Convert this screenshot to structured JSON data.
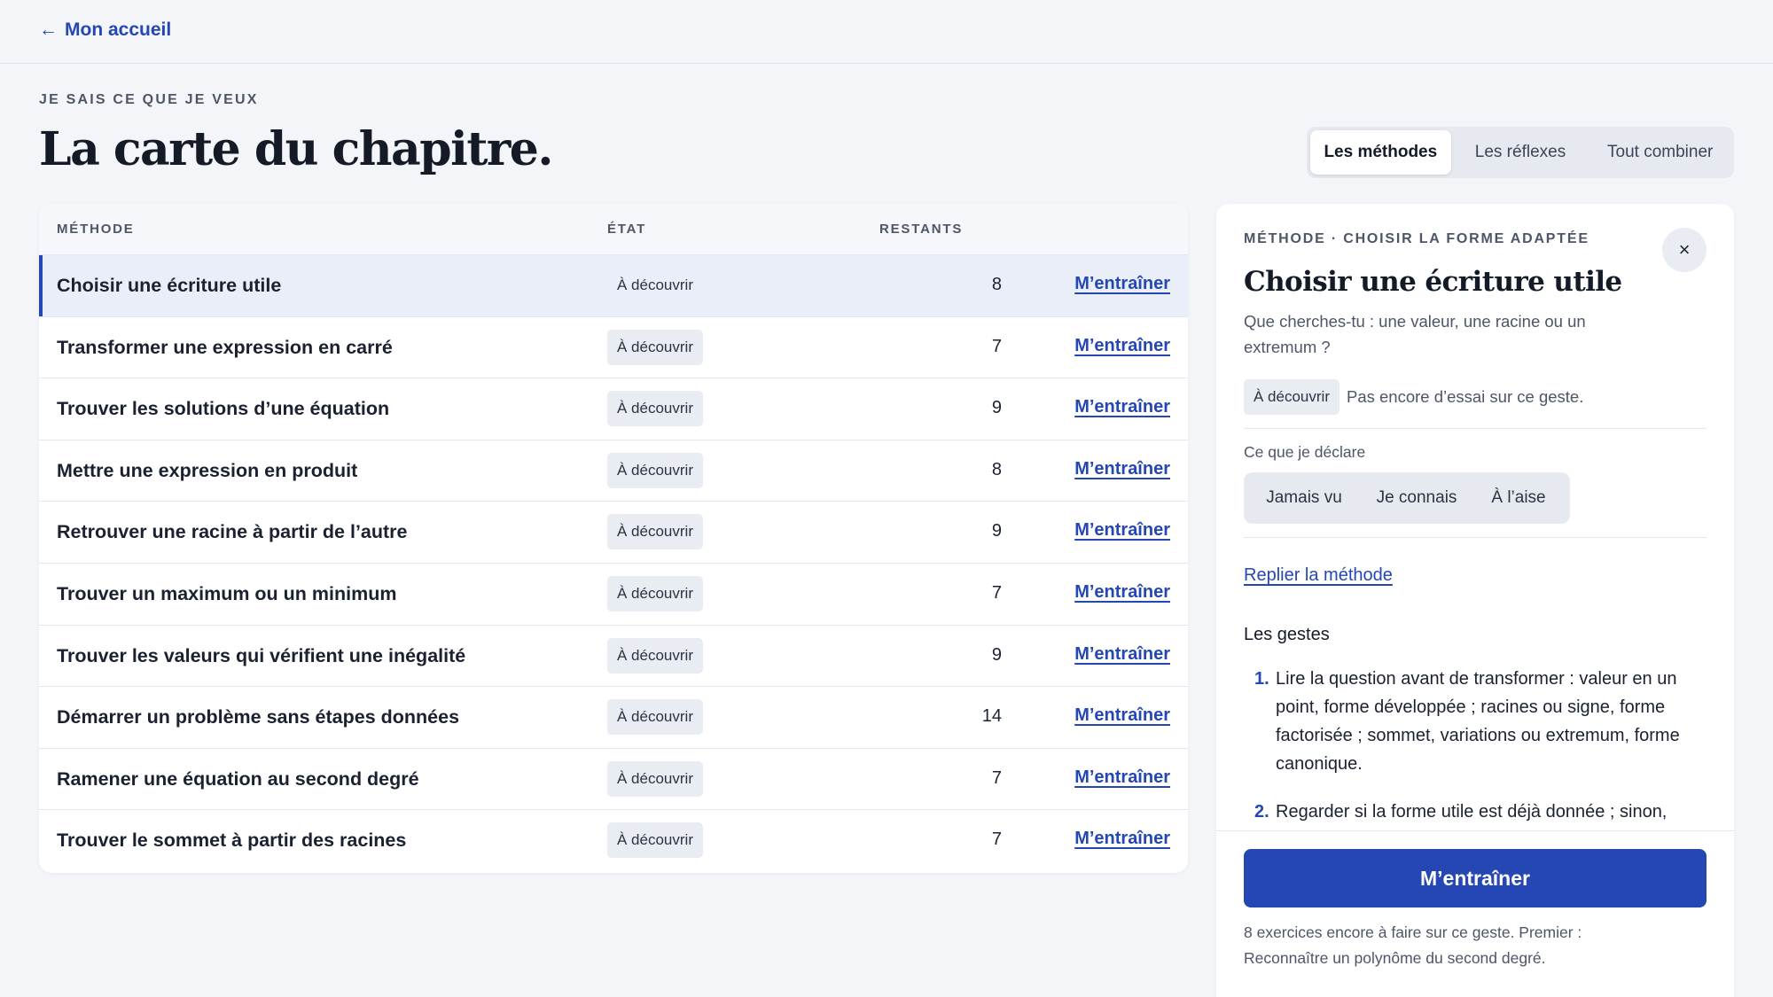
{
  "nav": {
    "back_arrow": "←",
    "back_label": "Mon accueil"
  },
  "header": {
    "eyebrow": "JE SAIS CE QUE JE VEUX",
    "title": "La carte du chapitre."
  },
  "tabs": [
    {
      "label": "Les méthodes",
      "active": true
    },
    {
      "label": "Les réflexes",
      "active": false
    },
    {
      "label": "Tout combiner",
      "active": false
    }
  ],
  "table": {
    "columns": {
      "method": "MÉTHODE",
      "state": "ÉTAT",
      "remaining": "RESTANTS"
    },
    "rows": [
      {
        "name": "Choisir une écriture utile",
        "state": "À découvrir",
        "remaining": "8",
        "action": "M’entraîner",
        "selected": true
      },
      {
        "name": "Transformer une expression en carré",
        "state": "À découvrir",
        "remaining": "7",
        "action": "M’entraîner"
      },
      {
        "name": "Trouver les solutions d’une équation",
        "state": "À découvrir",
        "remaining": "9",
        "action": "M’entraîner"
      },
      {
        "name": "Mettre une expression en produit",
        "state": "À découvrir",
        "remaining": "8",
        "action": "M’entraîner"
      },
      {
        "name": "Retrouver une racine à partir de l’autre",
        "state": "À découvrir",
        "remaining": "9",
        "action": "M’entraîner"
      },
      {
        "name": "Trouver un maximum ou un minimum",
        "state": "À découvrir",
        "remaining": "7",
        "action": "M’entraîner"
      },
      {
        "name": "Trouver les valeurs qui vérifient une inégalité",
        "state": "À découvrir",
        "remaining": "9",
        "action": "M’entraîner"
      },
      {
        "name": "Démarrer un problème sans étapes données",
        "state": "À découvrir",
        "remaining": "14",
        "action": "M’entraîner"
      },
      {
        "name": "Ramener une équation au second degré",
        "state": "À découvrir",
        "remaining": "7",
        "action": "M’entraîner"
      },
      {
        "name": "Trouver le sommet à partir des racines",
        "state": "À découvrir",
        "remaining": "7",
        "action": "M’entraîner"
      }
    ]
  },
  "panel": {
    "eyebrow": "MÉTHODE · CHOISIR LA FORME ADAPTÉE",
    "close_icon": "×",
    "title": "Choisir une écriture utile",
    "subtitle": "Que cherches-tu : une valeur, une racine ou un extremum ?",
    "status_badge": "À découvrir",
    "status_text": "Pas encore d’essai sur ce geste.",
    "declare_label": "Ce que je déclare",
    "declare_options": [
      "Jamais vu",
      "Je connais",
      "À l’aise"
    ],
    "replier": "Replier la méthode",
    "gestes_title": "Les gestes",
    "steps": [
      {
        "num": "1.",
        "text": "Lire la question avant de transformer : valeur en un point, forme développée ; racines ou signe, forme factorisée ; sommet, variations ou extremum, forme canonique."
      },
      {
        "num": "2.",
        "text": "Regarder si la forme utile est déjà donnée ; sinon,"
      }
    ],
    "cta": "M’entraîner",
    "footer_note": "8 exercices encore à faire sur ce geste. Premier : Reconnaître un polynôme du second degré."
  },
  "colors": {
    "accent": "#2447b3",
    "background": "#f3f5f9",
    "badge": "#e9ecf2",
    "selected_row": "#eaeef8"
  }
}
